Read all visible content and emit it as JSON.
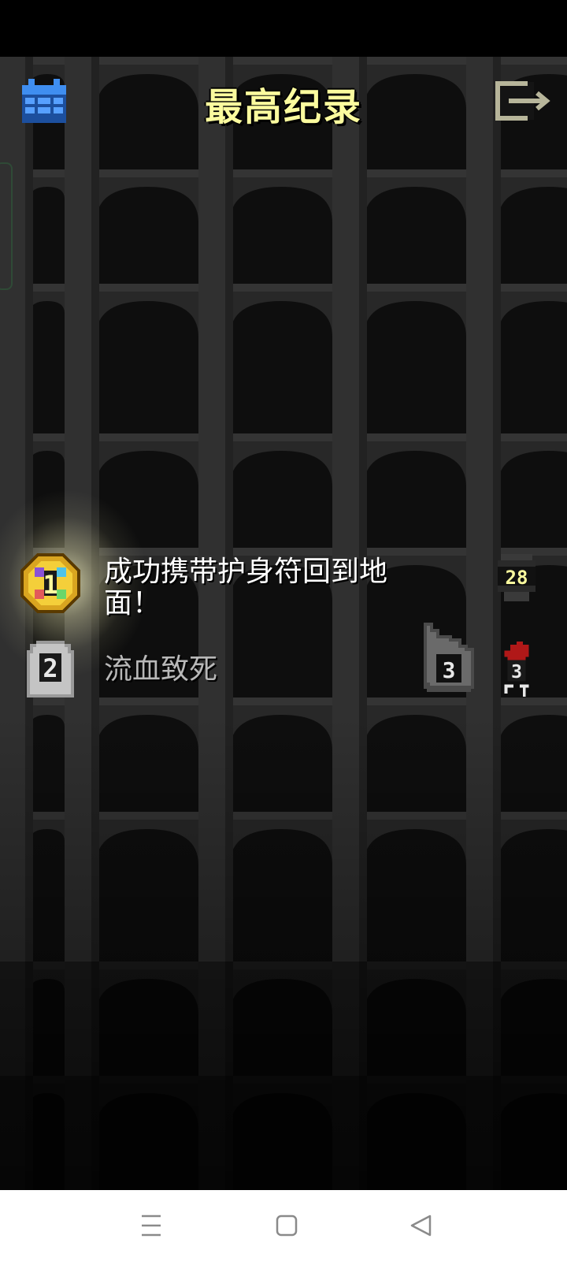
{
  "header": {
    "title": "最高纪录",
    "left_icon": "calendar-icon",
    "right_icon": "exit-icon"
  },
  "records": [
    {
      "rank": "1",
      "badge": "gold-rank-badge",
      "description": "成功携带护身符回到地面！",
      "depth": "28",
      "highlighted": true
    },
    {
      "rank": "2",
      "badge": "tombstone-rank-badge",
      "description": "流血致死",
      "level": "3",
      "depth": "3",
      "highlighted": false
    }
  ],
  "navbar": {
    "icons": [
      "menu-icon",
      "home-icon",
      "back-icon"
    ]
  },
  "colors": {
    "title": "#fbfb9e",
    "calendar": "#3f8ef0",
    "exit": "#b7b59a",
    "highlight_text": "#ffffff",
    "normal_text": "#b8b8b8"
  }
}
